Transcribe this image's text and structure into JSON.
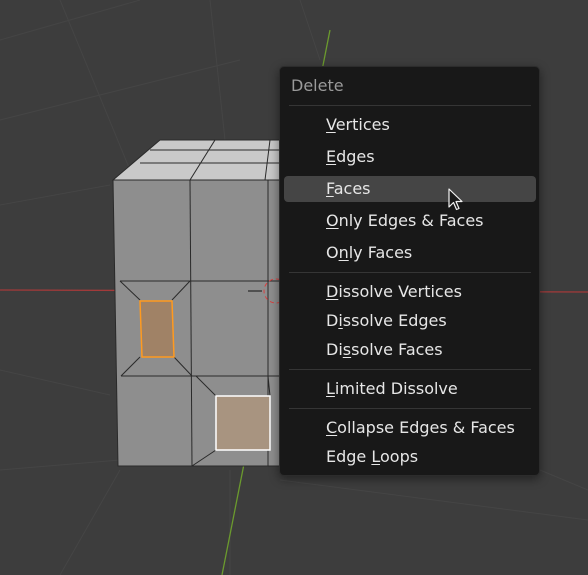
{
  "menu": {
    "title": "Delete",
    "items": [
      {
        "pre": "",
        "key": "V",
        "post": "ertices"
      },
      {
        "pre": "",
        "key": "E",
        "post": "dges"
      },
      {
        "pre": "",
        "key": "F",
        "post": "aces"
      },
      {
        "pre": "",
        "key": "O",
        "post": "nly Edges & Faces"
      },
      {
        "pre": "O",
        "key": "n",
        "post": "ly Faces"
      },
      {
        "pre": "",
        "key": "D",
        "post": "issolve Vertices"
      },
      {
        "pre": "D",
        "key": "i",
        "post": "ssolve Edges"
      },
      {
        "pre": "Di",
        "key": "s",
        "post": "solve Faces"
      },
      {
        "pre": "",
        "key": "L",
        "post": "imited Dissolve"
      },
      {
        "pre": "",
        "key": "C",
        "post": "ollapse Edges & Faces"
      },
      {
        "pre": "Edge ",
        "key": "L",
        "post": "oops"
      }
    ],
    "highlighted_item": "Faces"
  },
  "colors": {
    "viewport_bg": "#3d3d3d",
    "menu_bg": "#181818",
    "highlight_bg": "#454545",
    "text": "#e6e6e6",
    "title_text": "#9a9a9a",
    "selected_face": "#ff9a1f",
    "active_face": "#ffffff",
    "axis_x": "#a33a3a",
    "axis_y": "#6b9a2e"
  },
  "icons": {
    "cursor": "mouse-pointer-icon",
    "origin": "object-origin-icon"
  }
}
